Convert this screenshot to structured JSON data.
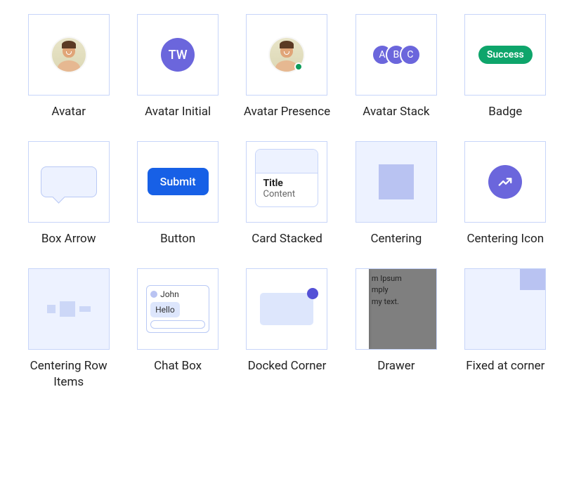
{
  "items": [
    {
      "label": "Avatar"
    },
    {
      "label": "Avatar Initial",
      "initials": "TW"
    },
    {
      "label": "Avatar Presence"
    },
    {
      "label": "Avatar Stack",
      "stack": [
        "A",
        "B",
        "C"
      ]
    },
    {
      "label": "Badge",
      "badge_text": "Success"
    },
    {
      "label": "Box Arrow"
    },
    {
      "label": "Button",
      "button_text": "Submit"
    },
    {
      "label": "Card Stacked",
      "card_title": "Title",
      "card_content": "Content"
    },
    {
      "label": "Centering"
    },
    {
      "label": "Centering Icon"
    },
    {
      "label": "Centering Row Items"
    },
    {
      "label": "Chat Box",
      "chat_user": "John",
      "chat_message": "Hello"
    },
    {
      "label": "Docked Corner"
    },
    {
      "label": "Drawer",
      "drawer_text": "m Ipsum\nmply\nmy text."
    },
    {
      "label": "Fixed at corner"
    }
  ]
}
